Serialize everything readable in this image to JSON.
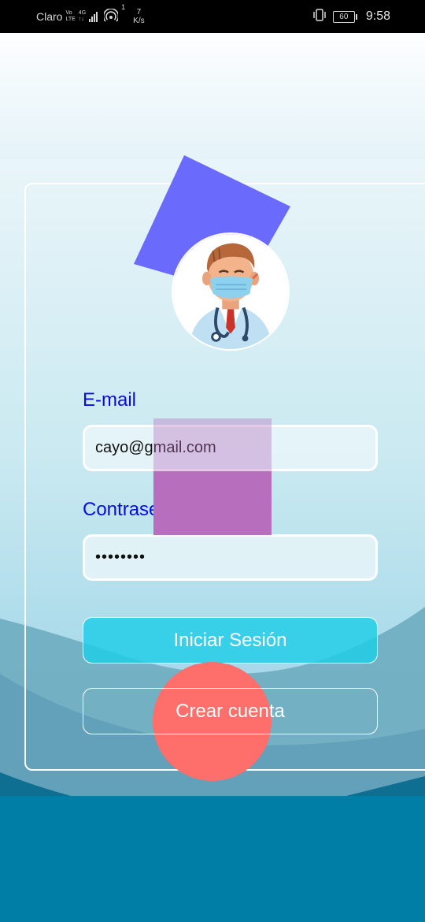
{
  "status_bar": {
    "carrier": "Claro",
    "network_top": "Vo",
    "network_bottom": "LTE",
    "gen_top": "4G",
    "gen_bottom": "↑↓",
    "data_sup": "1",
    "speed_value": "7",
    "speed_unit": "K/s",
    "battery": "60",
    "time": "9:58",
    "icons": [
      "signal-bars-icon",
      "hotspot-icon",
      "vibrate-icon",
      "battery-icon"
    ]
  },
  "login": {
    "email_label": "E-mail",
    "email_value": "cayo@gmail.com",
    "password_label": "Contraseña",
    "password_value": "••••••••",
    "login_button": "Iniciar Sesión",
    "create_button": "Crear cuenta"
  },
  "colors": {
    "label": "#0b0bdc",
    "login_button": "#1ecde8",
    "decor_square": "#6a6afd",
    "decor_rect": "#b76fbd",
    "decor_circle": "#fe6e6a",
    "bottom_band": "#007ea6"
  },
  "avatar": {
    "icon": "doctor-avatar-icon"
  }
}
